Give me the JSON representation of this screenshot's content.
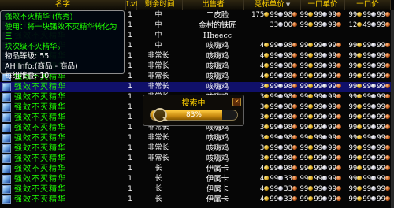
{
  "header": {
    "name": "名字",
    "lvl": "Lvl",
    "time": "剩余时间",
    "seller": "出售者",
    "bid": "竞标单价",
    "buyout": "一口单价",
    "buyout2": "一口价",
    "sort_glyph": "▼"
  },
  "tooltip": {
    "title": "强效不灭精华 (优秀)",
    "use_line1": "使用：将一块强效不灭精华转化为三",
    "use_line2": "块次级不灭精华。",
    "item_level": "物品等级: 55",
    "ah_info": "AH Info:(商品 - 商品)",
    "stack": "每组堆叠: 10"
  },
  "search": {
    "title": "搜索中",
    "percent": "83%",
    "progress": 0.83,
    "close": "✕"
  },
  "rows": [
    {
      "name": "强效不灭精华",
      "lvl": "1",
      "time": "中",
      "seller": "二皮脸",
      "bid": {
        "g": "175",
        "s": "99",
        "c": "98"
      },
      "buy": {
        "g": "99",
        "s": "99",
        "c": "99"
      },
      "unit": {
        "g": "99",
        "s": "99",
        "c": "99"
      }
    },
    {
      "name": "强效不灭精华",
      "lvl": "1",
      "time": "中",
      "seller": "金村的铁匠",
      "bid": {
        "g": "",
        "s": "33",
        "c": "00"
      },
      "buy": {
        "g": "99",
        "s": "99",
        "c": "99"
      },
      "unit": {
        "g": "12",
        "s": "49",
        "c": "99"
      }
    },
    {
      "name": "强效不灭精华",
      "lvl": "1",
      "time": "中",
      "seller": "Hheecc",
      "bid": {
        "g": "",
        "s": "",
        "c": ""
      },
      "buy": {
        "g": "",
        "s": "",
        "c": ""
      },
      "unit": {
        "g": "",
        "s": "",
        "c": ""
      }
    },
    {
      "name": "强效不灭精华",
      "lvl": "1",
      "time": "中",
      "seller": "咳嗨鸡",
      "bid": {
        "g": "4",
        "s": "99",
        "c": "98"
      },
      "buy": {
        "g": "99",
        "s": "99",
        "c": "99"
      },
      "unit": {
        "g": "99",
        "s": "99",
        "c": "99"
      }
    },
    {
      "name": "强效不灭精华",
      "lvl": "1",
      "time": "非常长",
      "seller": "咳嗨鸡",
      "bid": {
        "g": "4",
        "s": "99",
        "c": "98"
      },
      "buy": {
        "g": "99",
        "s": "99",
        "c": "99"
      },
      "unit": {
        "g": "99",
        "s": "99",
        "c": "99"
      }
    },
    {
      "name": "强效不灭精华",
      "lvl": "1",
      "time": "非常长",
      "seller": "咳嗨鸡",
      "bid": {
        "g": "4",
        "s": "99",
        "c": "98"
      },
      "buy": {
        "g": "99",
        "s": "99",
        "c": "99"
      },
      "unit": {
        "g": "99",
        "s": "99",
        "c": "99"
      }
    },
    {
      "name": "强效不灭精华",
      "lvl": "1",
      "time": "非常长",
      "seller": "咳嗨鸡",
      "bid": {
        "g": "4",
        "s": "99",
        "c": "98"
      },
      "buy": {
        "g": "99",
        "s": "99",
        "c": "99"
      },
      "unit": {
        "g": "99",
        "s": "99",
        "c": "99"
      }
    },
    {
      "name": "强效不灭精华",
      "lvl": "1",
      "time": "非常长",
      "seller": "咳嗨鸡",
      "bid": {
        "g": "3",
        "s": "99",
        "c": "98"
      },
      "buy": {
        "g": "99",
        "s": "99",
        "c": "99"
      },
      "unit": {
        "g": "99",
        "s": "99",
        "c": "99"
      }
    },
    {
      "name": "强效不灭精华",
      "lvl": "1",
      "time": "非常长",
      "seller": "咳嗨鸡",
      "bid": {
        "g": "3",
        "s": "99",
        "c": "98"
      },
      "buy": {
        "g": "99",
        "s": "99",
        "c": "99"
      },
      "unit": {
        "g": "99",
        "s": "99",
        "c": "99"
      }
    },
    {
      "name": "强效不灭精华",
      "lvl": "1",
      "time": "非常长",
      "seller": "咳嗨鸡",
      "bid": {
        "g": "3",
        "s": "99",
        "c": "98"
      },
      "buy": {
        "g": "99",
        "s": "99",
        "c": "99"
      },
      "unit": {
        "g": "99",
        "s": "99",
        "c": "99"
      }
    },
    {
      "name": "强效不灭精华",
      "lvl": "1",
      "time": "非常长",
      "seller": "咳嗨鸡",
      "bid": {
        "g": "3",
        "s": "99",
        "c": "98"
      },
      "buy": {
        "g": "99",
        "s": "99",
        "c": "99"
      },
      "unit": {
        "g": "99",
        "s": "99",
        "c": "99"
      }
    },
    {
      "name": "强效不灭精华",
      "lvl": "1",
      "time": "非常长",
      "seller": "咳嗨鸡",
      "bid": {
        "g": "3",
        "s": "99",
        "c": "98"
      },
      "buy": {
        "g": "99",
        "s": "99",
        "c": "99"
      },
      "unit": {
        "g": "99",
        "s": "99",
        "c": "99"
      }
    },
    {
      "name": "强效不灭精华",
      "lvl": "1",
      "time": "非常长",
      "seller": "咳嗨鸡",
      "bid": {
        "g": "3",
        "s": "99",
        "c": "98"
      },
      "buy": {
        "g": "99",
        "s": "99",
        "c": "99"
      },
      "unit": {
        "g": "99",
        "s": "99",
        "c": "99"
      }
    },
    {
      "name": "强效不灭精华",
      "lvl": "1",
      "time": "非常长",
      "seller": "咳嗨鸡",
      "bid": {
        "g": "3",
        "s": "99",
        "c": "98"
      },
      "buy": {
        "g": "99",
        "s": "99",
        "c": "99"
      },
      "unit": {
        "g": "99",
        "s": "99",
        "c": "99"
      }
    },
    {
      "name": "强效不灭精华",
      "lvl": "1",
      "time": "非常长",
      "seller": "咳嗨鸡",
      "bid": {
        "g": "3",
        "s": "99",
        "c": "98"
      },
      "buy": {
        "g": "99",
        "s": "99",
        "c": "99"
      },
      "unit": {
        "g": "99",
        "s": "99",
        "c": "99"
      }
    },
    {
      "name": "强效不灭精华",
      "lvl": "1",
      "time": "长",
      "seller": "伊属卡",
      "bid": {
        "g": "4",
        "s": "99",
        "c": "98"
      },
      "buy": {
        "g": "99",
        "s": "99",
        "c": "99"
      },
      "unit": {
        "g": "99",
        "s": "99",
        "c": "99"
      }
    },
    {
      "name": "强效不灭精华",
      "lvl": "1",
      "time": "长",
      "seller": "伊属卡",
      "bid": {
        "g": "4",
        "s": "99",
        "c": "33"
      },
      "buy": {
        "g": "99",
        "s": "99",
        "c": "99"
      },
      "unit": {
        "g": "99",
        "s": "99",
        "c": "99"
      }
    },
    {
      "name": "强效不灭精华",
      "lvl": "1",
      "time": "长",
      "seller": "伊属卡",
      "bid": {
        "g": "4",
        "s": "99",
        "c": "33"
      },
      "buy": {
        "g": "99",
        "s": "99",
        "c": "99"
      },
      "unit": {
        "g": "99",
        "s": "99",
        "c": "99"
      }
    },
    {
      "name": "强效不灭精华",
      "lvl": "1",
      "time": "长",
      "seller": "伊属卡",
      "bid": {
        "g": "4",
        "s": "99",
        "c": "33"
      },
      "buy": {
        "g": "99",
        "s": "99",
        "c": "99"
      },
      "unit": {
        "g": "99",
        "s": "99",
        "c": "99"
      }
    }
  ],
  "selected_row": 7
}
